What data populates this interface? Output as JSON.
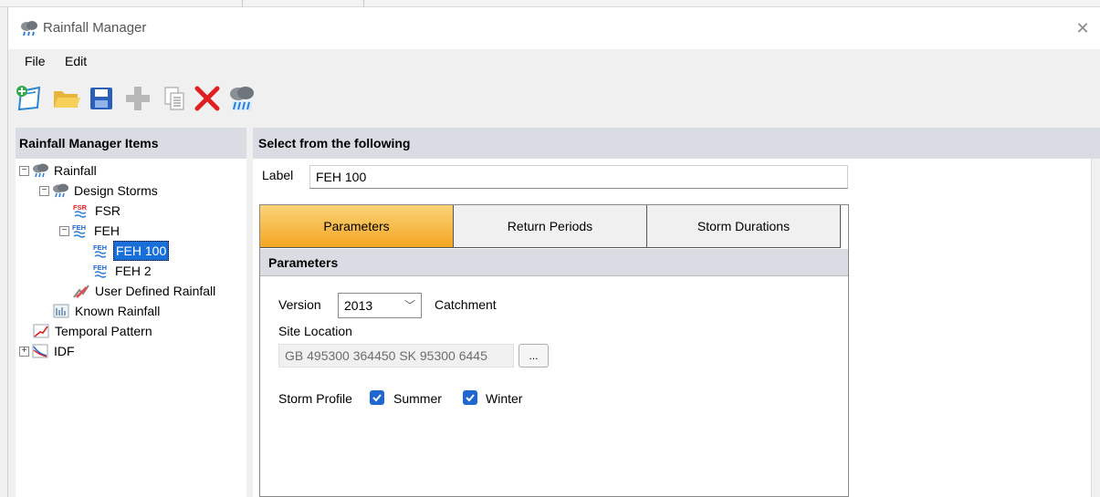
{
  "window": {
    "title": "Rainfall Manager",
    "close_glyph": "✕"
  },
  "menu": {
    "file_label": "File",
    "edit_label": "Edit"
  },
  "toolbar": {
    "icons": [
      "new-icon",
      "open-folder-icon",
      "save-icon",
      "add-icon",
      "copy-icon",
      "delete-icon",
      "rainfall-icon"
    ]
  },
  "left_panel": {
    "header": "Rainfall Manager Items",
    "tree": {
      "rainfall": "Rainfall",
      "design_storms": "Design Storms",
      "fsr": "FSR",
      "feh": "FEH",
      "feh_100": "FEH 100",
      "feh_2": "FEH 2",
      "user_defined": "User Defined Rainfall",
      "known_rainfall": "Known Rainfall",
      "temporal_pattern": "Temporal Pattern",
      "idf": "IDF",
      "expanded_glyph": "−",
      "collapsed_glyph": "+"
    }
  },
  "right_panel": {
    "header": "Select from the following",
    "label_caption": "Label",
    "label_value": "FEH 100",
    "tabs": {
      "parameters": "Parameters",
      "return_periods": "Return Periods",
      "storm_durations": "Storm Durations"
    },
    "section_title": "Parameters",
    "version_caption": "Version",
    "version_value": "2013",
    "version_chevron": "﹀",
    "catchment_caption": "Catchment",
    "site_location_caption": "Site Location",
    "site_location_value": "GB 495300 364450 SK 95300 6445",
    "ellipsis_label": "...",
    "storm_profile_caption": "Storm Profile",
    "summer_label": "Summer",
    "summer_checked": true,
    "winter_label": "Winter",
    "winter_checked": true
  },
  "colors": {
    "accent": "#1e66d0",
    "tab_active": "#f5a623",
    "header_bg": "#d9dde3",
    "delete_red": "#e02020"
  }
}
